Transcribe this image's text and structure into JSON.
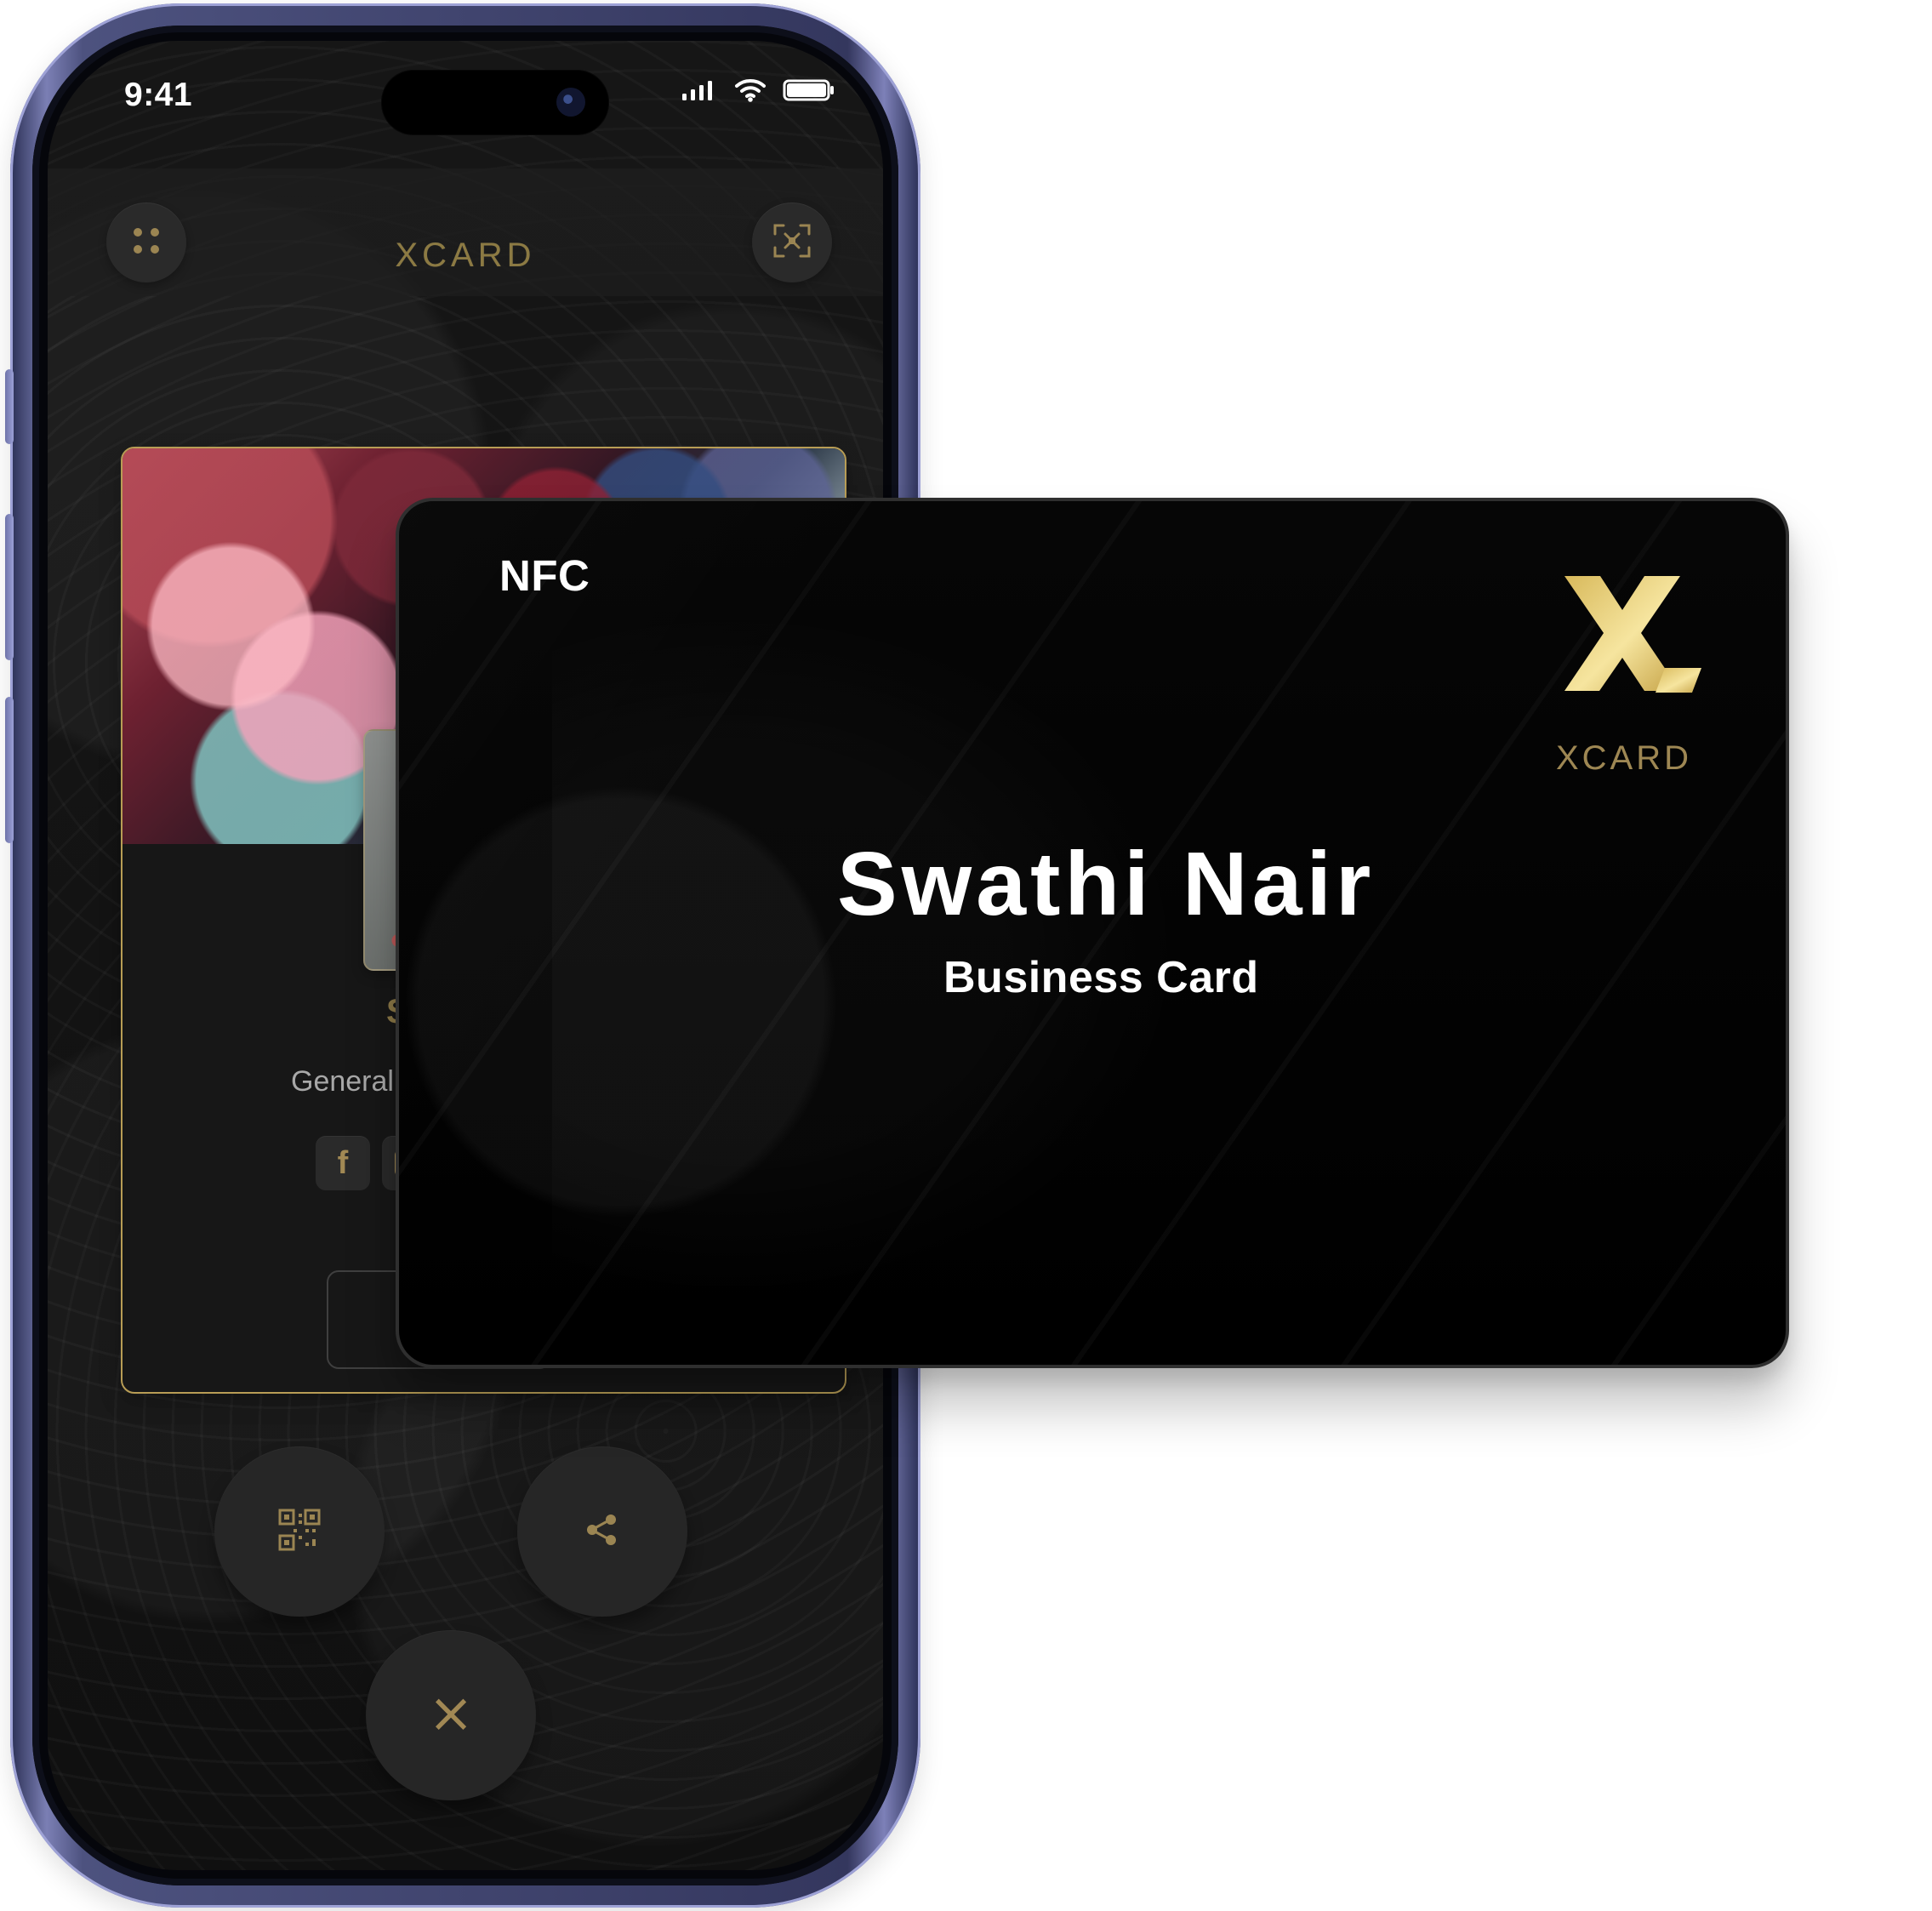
{
  "phone": {
    "status_bar": {
      "time": "9:41",
      "icons": [
        "signal-icon",
        "wifi-icon",
        "battery-icon"
      ]
    },
    "header": {
      "brand": "XCARD",
      "left_icon": "grid-icon",
      "right_icon": "scan-icon"
    },
    "back_card": {
      "name_partial": "S",
      "role_partial": "General Mar",
      "social_icons": [
        "facebook-icon",
        "instagram-icon"
      ]
    },
    "actions": {
      "qr_icon": "qr-code-icon",
      "share_icon": "share-icon",
      "close_icon": "close-icon"
    }
  },
  "nfc_card": {
    "label": "NFC",
    "brand": "XCARD",
    "name": "Swathi Nair",
    "subtitle": "Business Card",
    "logo_icon": "xcard-logo-icon"
  },
  "colors": {
    "gold": "#b89d55",
    "dark": "#101010",
    "white": "#ffffff",
    "phone_frame": "#4d527f"
  }
}
